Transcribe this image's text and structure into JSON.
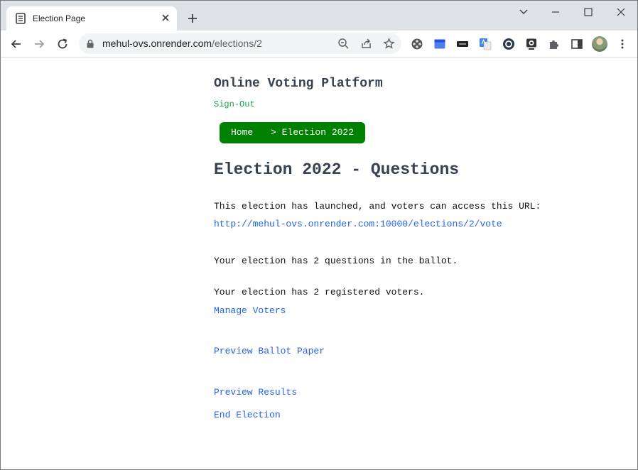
{
  "browser": {
    "tab_title": "Election Page",
    "url_host": "mehul-ovs.onrender.com",
    "url_path": "/elections/2",
    "icons": [
      "document-icon",
      "close-icon",
      "plus-icon",
      "chevron-down-icon",
      "minimize-icon",
      "maximize-icon",
      "back-arrow-icon",
      "forward-arrow-icon",
      "reload-icon",
      "lock-icon",
      "zoom-icon",
      "share-icon",
      "star-icon",
      "film-reel-icon",
      "calendar-icon",
      "keyboard-icon",
      "translate-icon",
      "grammar-icon",
      "webcam-icon",
      "puzzle-icon",
      "side-panel-icon",
      "avatar",
      "kebab-menu-icon"
    ]
  },
  "page": {
    "site_title": "Online Voting Platform",
    "signout_label": "Sign-Out",
    "breadcrumb": {
      "home": "Home",
      "current": "> Election 2022"
    },
    "heading": "Election 2022 - Questions",
    "launched_text": "This election has launched, and voters can access this URL:",
    "vote_url": "http://mehul-ovs.onrender.com:10000/elections/2/vote",
    "questions_text": "Your election has 2 questions in the ballot.",
    "voters_text": "Your election has 2 registered voters.",
    "manage_voters": "Manage Voters",
    "preview_ballot": "Preview Ballot Paper",
    "preview_results": "Preview Results",
    "end_election": "End Election"
  },
  "colors": {
    "breadcrumb_bg": "#008000",
    "signout": "#16a34a",
    "link": "#2563eb",
    "heading": "#374151"
  }
}
